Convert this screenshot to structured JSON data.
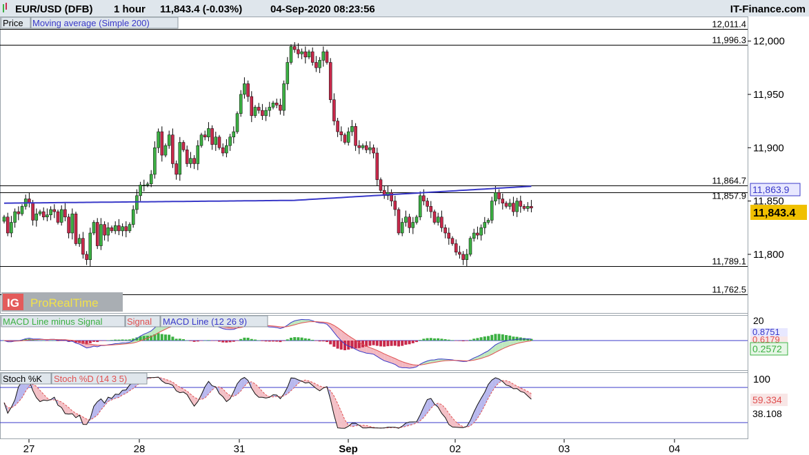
{
  "header": {
    "instrument": "EUR/USD (DFB)",
    "timeframe": "1 hour",
    "last_quote": "11,843.4 (-0.03%)",
    "datetime": "04-Sep-2020 08:23:56",
    "provider": "IT-Finance.com"
  },
  "price_panel": {
    "legend_price": "Price",
    "legend_ma": "Moving average (Simple 200)",
    "watermark_logo": "IG",
    "watermark": "ProRealTime",
    "ma_value_label": "11,863.9",
    "last_price_label": "11,843.4",
    "axis_ticks": [
      {
        "label": "12,000",
        "value": 12000
      },
      {
        "label": "11,950",
        "value": 11950
      },
      {
        "label": "11,900",
        "value": 11900
      },
      {
        "label": "11,850",
        "value": 11850
      },
      {
        "label": "11,800",
        "value": 11800
      }
    ],
    "hlines": [
      {
        "label": "12,011.4",
        "value": 12011.4
      },
      {
        "label": "11,996.3",
        "value": 11996.3
      },
      {
        "label": "11,864.7",
        "value": 11864.7
      },
      {
        "label": "11,857.9",
        "value": 11857.9
      },
      {
        "label": "11,789.1",
        "value": 11789.1
      },
      {
        "label": "11,762.5",
        "value": 11762.5
      }
    ]
  },
  "macd_panel": {
    "legend_hist": "MACD Line minus Signal",
    "legend_signal": "Signal",
    "legend_macd": "MACD Line (12 26 9)",
    "axis_top": "20",
    "label_macd": "0.8751",
    "label_signal": "0.6179",
    "label_hist": "0.2572"
  },
  "stoch_panel": {
    "legend_k": "Stoch %K",
    "legend_d": "Stoch %D (14 3 5)",
    "axis_top": "100",
    "label_d": "59.334",
    "label_k": "38.108"
  },
  "x_axis": [
    {
      "label": "27",
      "index": 4
    },
    {
      "label": "28",
      "index": 37
    },
    {
      "label": "31",
      "index": 69
    },
    {
      "label": "Sep",
      "index": 101
    },
    {
      "label": "02",
      "index": 133
    },
    {
      "label": "03",
      "index": 165
    },
    {
      "label": "04",
      "index": 197
    }
  ],
  "colors": {
    "bull": "#3cb043",
    "bear": "#c8294b",
    "ma": "#3838c8",
    "macd_line": "#3838c8",
    "signal_line": "#e05050",
    "stoch_k": "#111111",
    "stoch_d": "#e05050",
    "last_price_bg": "#f0c000",
    "ma_label_bg": "#e8e8ff",
    "hist_label_bg": "#e6f6e6",
    "signal_label_bg": "#f8e6e6",
    "legend_bg": "#dfe6ec"
  },
  "chart_data": [
    {
      "type": "candlestick",
      "title": "EUR/USD (DFB) 1 hour",
      "ylim": [
        11745,
        12023
      ],
      "closes": [
        11835,
        11820,
        11830,
        11840,
        11838,
        11845,
        11852,
        11848,
        11832,
        11838,
        11840,
        11835,
        11837,
        11842,
        11840,
        11830,
        11842,
        11835,
        11820,
        11838,
        11810,
        11815,
        11800,
        11795,
        11820,
        11830,
        11808,
        11828,
        11818,
        11825,
        11822,
        11827,
        11822,
        11826,
        11822,
        11828,
        11842,
        11855,
        11865,
        11865,
        11866,
        11875,
        11900,
        11915,
        11893,
        11902,
        11912,
        11885,
        11875,
        11905,
        11898,
        11885,
        11890,
        11885,
        11902,
        11912,
        11910,
        11918,
        11903,
        11910,
        11900,
        11895,
        11902,
        11910,
        11915,
        11932,
        11950,
        11960,
        11948,
        11930,
        11938,
        11935,
        11930,
        11935,
        11938,
        11942,
        11940,
        11935,
        11960,
        11980,
        11995,
        11992,
        11988,
        11990,
        11985,
        11990,
        11980,
        11975,
        11982,
        11990,
        11980,
        11945,
        11925,
        11915,
        11912,
        11905,
        11915,
        11920,
        11902,
        11900,
        11902,
        11898,
        11900,
        11895,
        11870,
        11860,
        11855,
        11858,
        11850,
        11842,
        11820,
        11830,
        11835,
        11825,
        11830,
        11835,
        11855,
        11850,
        11845,
        11840,
        11830,
        11835,
        11825,
        11820,
        11815,
        11810,
        11802,
        11800,
        11795,
        11800,
        11815,
        11820,
        11818,
        11825,
        11830,
        11832,
        11850,
        11858,
        11852,
        11848,
        11845,
        11848,
        11840,
        11850,
        11845,
        11843,
        11845,
        11843.4
      ]
    },
    {
      "type": "line",
      "series": [
        {
          "name": "Moving average (Simple 200)",
          "start": 11848,
          "end": 11863.9
        }
      ]
    },
    {
      "type": "bar",
      "series": [
        {
          "name": "MACD Line minus Signal",
          "last": 0.2572
        },
        {
          "name": "Signal",
          "last": 0.6179
        },
        {
          "name": "MACD Line (12 26 9)",
          "last": 0.8751
        }
      ]
    },
    {
      "type": "line",
      "ylim": [
        0,
        100
      ],
      "series": [
        {
          "name": "Stoch %K",
          "last": 38.108
        },
        {
          "name": "Stoch %D (14 3 5)",
          "last": 59.334
        }
      ]
    }
  ]
}
